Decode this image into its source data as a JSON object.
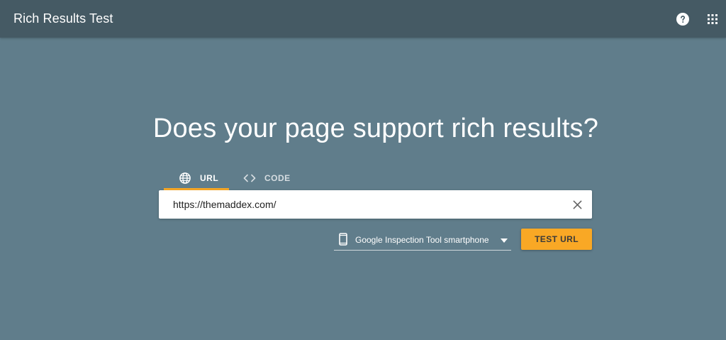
{
  "header": {
    "title": "Rich Results Test",
    "icons": [
      "help-icon",
      "apps-icon"
    ]
  },
  "main": {
    "headline": "Does your page support rich results?",
    "tabs": [
      {
        "label": "URL",
        "icon": "globe-icon",
        "active": true
      },
      {
        "label": "CODE",
        "icon": "code-icon",
        "active": false
      }
    ],
    "url_input": {
      "value": "https://themaddex.com/",
      "clear_icon": "close-icon"
    },
    "user_agent": {
      "selected": "Google Inspection Tool smartphone",
      "icon": "smartphone-icon"
    },
    "test_button_label": "TEST URL"
  },
  "colors": {
    "background": "#607d8b",
    "topbar": "#455a64",
    "accent": "#f9a825"
  }
}
